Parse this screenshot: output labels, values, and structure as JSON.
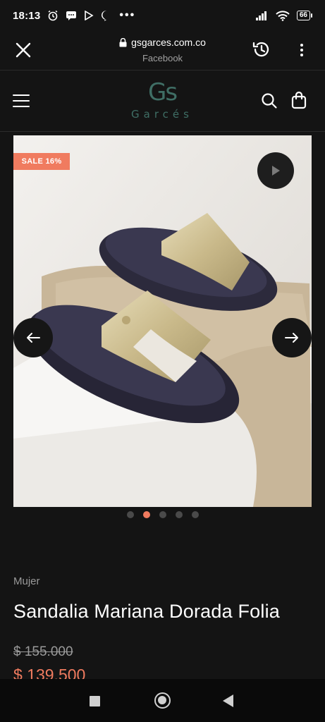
{
  "status_bar": {
    "time": "18:13",
    "battery": "66",
    "icons": [
      "alarm-icon",
      "message-icon",
      "play-store-icon",
      "messenger-icon",
      "more-dots-icon",
      "signal-icon",
      "wifi-icon",
      "battery-icon"
    ]
  },
  "browser": {
    "url": "gsgarces.com.co",
    "subtitle": "Facebook"
  },
  "header": {
    "logo_mark": "Gs",
    "logo_word": "Garcés"
  },
  "gallery": {
    "badge": "SALE 16%",
    "slide_count": 5,
    "active_slide": 2
  },
  "product": {
    "category": "Mujer",
    "title": "Sandalia Mariana Dorada Folia",
    "old_price": "$ 155.000",
    "new_price": "$ 139.500"
  },
  "colors": {
    "accent": "#f07b5f",
    "brand": "#3f6e65",
    "background": "#141414"
  }
}
